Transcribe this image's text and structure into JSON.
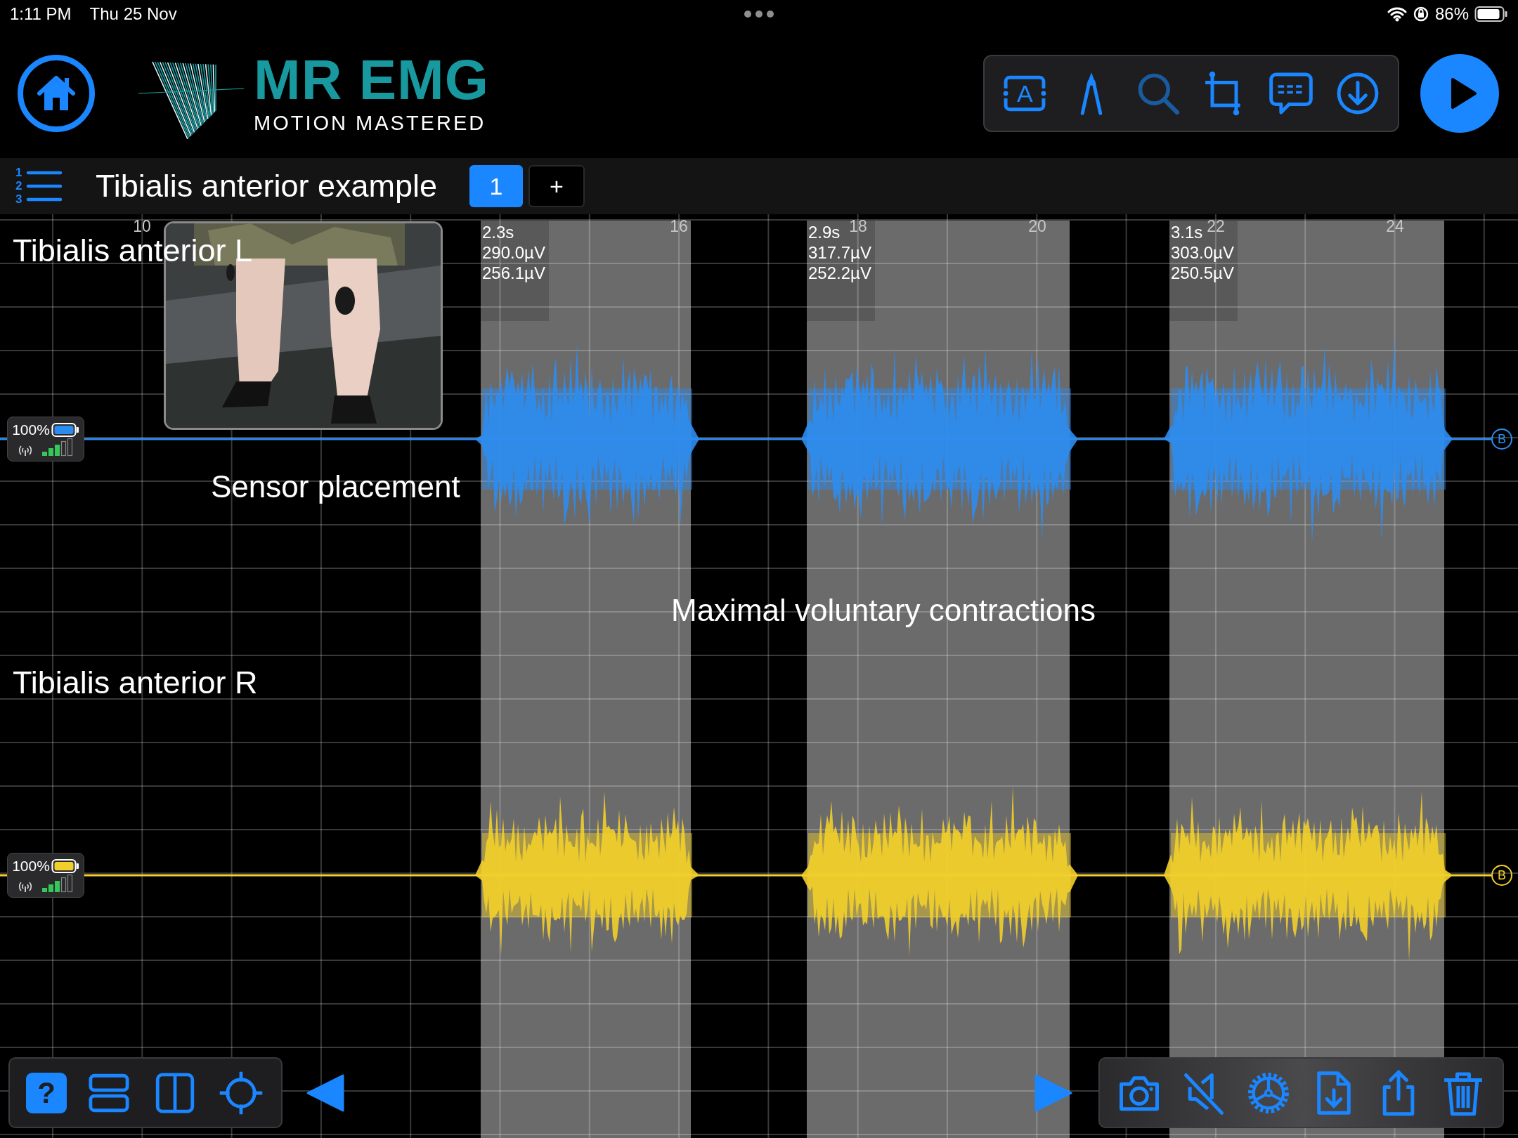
{
  "status_bar": {
    "time": "1:11 PM",
    "date": "Thu 25 Nov",
    "battery": "86%"
  },
  "logo": {
    "title": "MR EMG",
    "subtitle": "MOTION MASTERED"
  },
  "top_tools": [
    {
      "kind": "text",
      "glyph": "A",
      "disabled": false
    },
    {
      "kind": "pen",
      "disabled": false
    },
    {
      "kind": "zoom",
      "disabled": true
    },
    {
      "kind": "crop",
      "disabled": false
    },
    {
      "kind": "comment",
      "disabled": false
    },
    {
      "kind": "download",
      "disabled": false
    }
  ],
  "session": {
    "list_digits": [
      "1",
      "2",
      "3"
    ],
    "title": "Tibialis anterior example",
    "tabs": [
      {
        "label": "1",
        "selected": true
      }
    ],
    "add_button": "+"
  },
  "ticks": [
    "10",
    "16",
    "18",
    "20",
    "22",
    "24"
  ],
  "selections": [
    {
      "duration": "2.3s",
      "peak": "290.0µV",
      "mean": "256.1µV"
    },
    {
      "duration": "2.9s",
      "peak": "317.7µV",
      "mean": "252.2µV"
    },
    {
      "duration": "3.1s",
      "peak": "303.0µV",
      "mean": "250.5µV"
    }
  ],
  "channels": [
    {
      "name": "Tibialis anterior L",
      "color": "#2d8cf0",
      "battery": "100%",
      "marker": "B"
    },
    {
      "name": "Tibialis anterior R",
      "color": "#f2cf2a",
      "battery": "100%",
      "marker": "B"
    }
  ],
  "photo": {
    "kind": "picture"
  },
  "annotations": [
    "Sensor placement",
    "Maximal voluntary contractions"
  ],
  "bottom_left_tools": [
    {
      "kind": "help",
      "glyph": "?",
      "selected": true
    },
    {
      "kind": "stacked",
      "selected": false
    },
    {
      "kind": "split",
      "selected": false
    },
    {
      "kind": "target",
      "selected": false
    }
  ],
  "bottom_right_tools": [
    {
      "kind": "camera"
    },
    {
      "kind": "mute"
    },
    {
      "kind": "wheel"
    },
    {
      "kind": "file-download"
    },
    {
      "kind": "share"
    },
    {
      "kind": "trash"
    }
  ]
}
